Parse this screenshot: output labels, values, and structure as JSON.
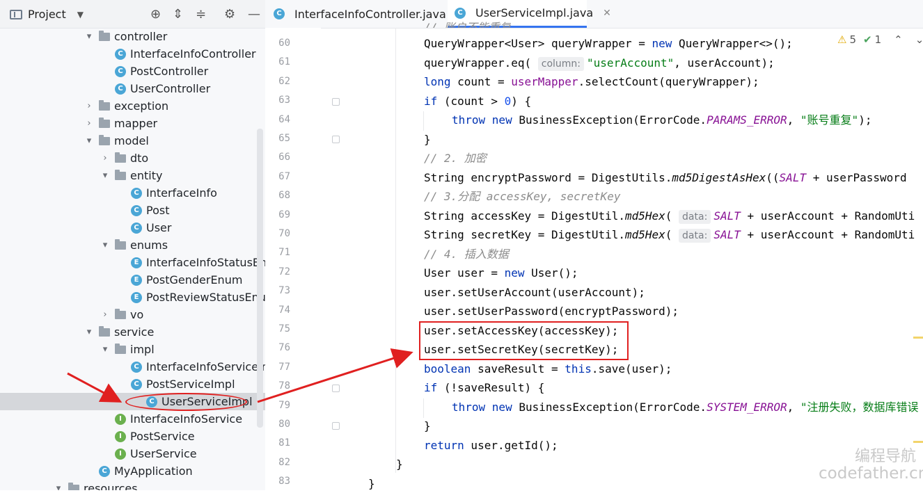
{
  "project_panel": {
    "title": "Project",
    "tree": [
      {
        "label": "controller",
        "type": "folder",
        "arrow": "▾",
        "indent": 1
      },
      {
        "label": "InterfaceInfoController",
        "type": "class",
        "indent": 2
      },
      {
        "label": "PostController",
        "type": "class",
        "indent": 2
      },
      {
        "label": "UserController",
        "type": "class",
        "indent": 2
      },
      {
        "label": "exception",
        "type": "folder",
        "arrow": "›",
        "indent": 1
      },
      {
        "label": "mapper",
        "type": "folder",
        "arrow": "›",
        "indent": 1
      },
      {
        "label": "model",
        "type": "folder",
        "arrow": "▾",
        "indent": 1
      },
      {
        "label": "dto",
        "type": "folder",
        "arrow": "›",
        "indent": 2
      },
      {
        "label": "entity",
        "type": "folder",
        "arrow": "▾",
        "indent": 2
      },
      {
        "label": "InterfaceInfo",
        "type": "class",
        "indent": 3
      },
      {
        "label": "Post",
        "type": "class",
        "indent": 3
      },
      {
        "label": "User",
        "type": "class",
        "indent": 3
      },
      {
        "label": "enums",
        "type": "folder",
        "arrow": "▾",
        "indent": 2
      },
      {
        "label": "InterfaceInfoStatusEnum",
        "type": "enum",
        "indent": 3
      },
      {
        "label": "PostGenderEnum",
        "type": "enum",
        "indent": 3
      },
      {
        "label": "PostReviewStatusEnum",
        "type": "enum",
        "indent": 3
      },
      {
        "label": "vo",
        "type": "folder",
        "arrow": "›",
        "indent": 2
      },
      {
        "label": "service",
        "type": "folder",
        "arrow": "▾",
        "indent": 1
      },
      {
        "label": "impl",
        "type": "folder",
        "arrow": "▾",
        "indent": 2
      },
      {
        "label": "InterfaceInfoServiceImpl",
        "type": "class",
        "indent": 3
      },
      {
        "label": "PostServiceImpl",
        "type": "class",
        "indent": 3
      },
      {
        "label": "UserServiceImpl",
        "type": "class",
        "indent": 3,
        "selected": true
      },
      {
        "label": "InterfaceInfoService",
        "type": "interface",
        "indent": 2
      },
      {
        "label": "PostService",
        "type": "interface",
        "indent": 2
      },
      {
        "label": "UserService",
        "type": "interface",
        "indent": 2
      },
      {
        "label": "MyApplication",
        "type": "app",
        "indent": 1
      },
      {
        "label": "resources",
        "type": "folder",
        "arrow": "▾",
        "indent": 0
      }
    ]
  },
  "tabs": [
    {
      "label": "InterfaceInfoController.java",
      "active": false
    },
    {
      "label": "UserServiceImpl.java",
      "active": true
    }
  ],
  "inspections": {
    "warnings": "5",
    "weak_warnings": "1"
  },
  "editor": {
    "line_numbers": [
      "60",
      "61",
      "62",
      "63",
      "64",
      "65",
      "66",
      "67",
      "68",
      "69",
      "70",
      "71",
      "72",
      "73",
      "74",
      "75",
      "76",
      "77",
      "78",
      "79",
      "80",
      "81",
      "82",
      "83"
    ],
    "hints": {
      "column": "column:",
      "data": "data:"
    }
  },
  "watermark": {
    "line1": "编程导航",
    "line2": "codefather.cn"
  },
  "colors": {
    "accent": "#3574f0",
    "annotation_red": "#e02020",
    "keyword": "#0033b3",
    "string": "#067d17",
    "field": "#871094"
  }
}
